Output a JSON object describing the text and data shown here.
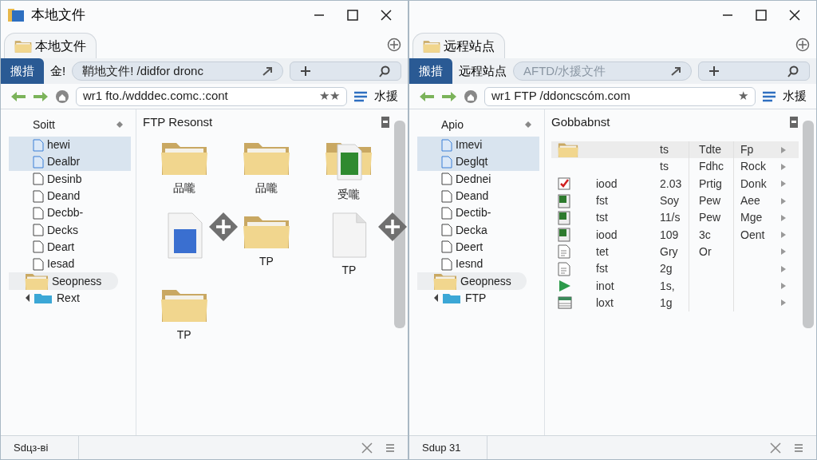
{
  "panes": [
    {
      "title": "本地文件",
      "tab": "本地文件",
      "nav_button": "搬措",
      "location_label": "金!",
      "path": "鞘地文件! /didfor dronc",
      "path_dim": false,
      "address": "wr1 fto./wdddec.comc.:cont",
      "stars": "★★",
      "toolbar_label": "水援",
      "sidebar": {
        "heading": "Soitt",
        "items": [
          {
            "label": "hewi",
            "kind": "doc",
            "selected": true,
            "hovered": false
          },
          {
            "label": "Dealbr",
            "kind": "doc",
            "selected": true,
            "hovered": false
          },
          {
            "label": "Desinb",
            "kind": "page",
            "selected": false,
            "hovered": false
          },
          {
            "label": "Deand",
            "kind": "page",
            "selected": false,
            "hovered": false
          },
          {
            "label": "Decbb-",
            "kind": "page",
            "selected": false,
            "hovered": false
          },
          {
            "label": "Decks",
            "kind": "page",
            "selected": false,
            "hovered": false
          },
          {
            "label": "Deart",
            "kind": "page",
            "selected": false,
            "hovered": false
          },
          {
            "label": "Iesad",
            "kind": "page",
            "selected": false,
            "hovered": false
          },
          {
            "label": "Seopness",
            "kind": "folder",
            "selected": false,
            "hovered": true
          },
          {
            "label": "Rext",
            "kind": "drive",
            "selected": false,
            "hovered": false
          }
        ]
      },
      "content": {
        "title": "FTP Resonst",
        "items": [
          {
            "kind": "folder",
            "label": "品嚨"
          },
          {
            "kind": "folder",
            "label": "品嚨"
          },
          {
            "kind": "folder-sheet",
            "label": "受嚨"
          },
          {
            "kind": "doc-blue"
          },
          {
            "kind": "folder",
            "label": "TP"
          },
          {
            "kind": "doc-blank",
            "label": "TP"
          },
          {
            "kind": "folder",
            "label": "TP"
          }
        ]
      },
      "status": "Sdцз-ві"
    },
    {
      "tab": "远程站点",
      "nav_button": "搬措",
      "location_label": "远程站点",
      "path": "AFTD/水援文件",
      "path_dim": true,
      "address": "wr1 FTP /ddoncscóm.com",
      "stars": "★",
      "toolbar_label": "水援",
      "sidebar": {
        "heading": "Apio",
        "items": [
          {
            "label": "Imevi",
            "kind": "doc",
            "selected": true,
            "hovered": false
          },
          {
            "label": "Deglqt",
            "kind": "doc",
            "selected": true,
            "hovered": false
          },
          {
            "label": "Dednei",
            "kind": "page",
            "selected": false,
            "hovered": false
          },
          {
            "label": "Deand",
            "kind": "page",
            "selected": false,
            "hovered": false
          },
          {
            "label": "Dectib-",
            "kind": "page",
            "selected": false,
            "hovered": false
          },
          {
            "label": "Decka",
            "kind": "page",
            "selected": false,
            "hovered": false
          },
          {
            "label": "Deert",
            "kind": "page",
            "selected": false,
            "hovered": false
          },
          {
            "label": "Iesnd",
            "kind": "page",
            "selected": false,
            "hovered": false
          },
          {
            "label": "Geopness",
            "kind": "folder",
            "selected": false,
            "hovered": true
          },
          {
            "label": "FTP",
            "kind": "drive",
            "selected": false,
            "hovered": false
          }
        ]
      },
      "content": {
        "title": "Gobbabnst",
        "rows": [
          {
            "kind": "folder",
            "size": "ts",
            "column_3": "Tdte",
            "column_4": "Fp",
            "selected": true
          },
          {
            "kind": "none",
            "size": "ts",
            "column_3": "Fdhc",
            "column_4": "Rock",
            "selected": false
          },
          {
            "kind": "check",
            "name": "iood",
            "size": "2.03",
            "column_3": "Prtig",
            "column_4": "Donk",
            "selected": false
          },
          {
            "kind": "sheet",
            "name": "fst",
            "size": "Soy",
            "column_3": "Pew",
            "column_4": "Aee",
            "selected": false
          },
          {
            "kind": "sheet",
            "name": "tst",
            "size": "11/s",
            "column_3": "Pew",
            "column_4": "Mge",
            "selected": false
          },
          {
            "kind": "sheet",
            "name": "iood",
            "size": "109",
            "column_3": "3c",
            "column_4": "Oent",
            "selected": false
          },
          {
            "kind": "text",
            "name": "tet",
            "size": "Gry",
            "column_3": "Or",
            "selected": false
          },
          {
            "kind": "text",
            "name": "fst",
            "size": "2g",
            "selected": false
          },
          {
            "kind": "play",
            "name": "inot",
            "size": "1s,",
            "selected": false
          },
          {
            "kind": "table",
            "name": "loxt",
            "size": "1g",
            "selected": false
          }
        ]
      },
      "status": "Sdup 31"
    }
  ]
}
